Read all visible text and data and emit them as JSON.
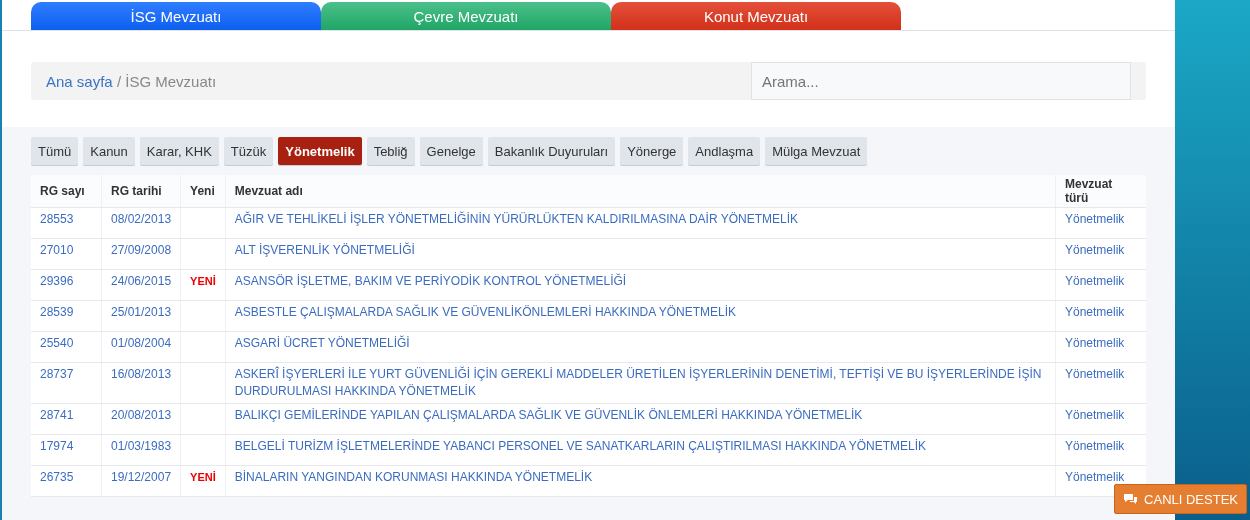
{
  "top_tabs": [
    {
      "label": "İSG Mevzuatı",
      "kind": "blue"
    },
    {
      "label": "Çevre Mevzuatı",
      "kind": "green"
    },
    {
      "label": "Konut Mevzuatı",
      "kind": "red"
    }
  ],
  "breadcrumb": {
    "home": "Ana sayfa",
    "separator": "/",
    "current": "İSG Mevzuatı"
  },
  "search": {
    "placeholder": "Arama..."
  },
  "filters": [
    {
      "label": "Tümü",
      "selected": false
    },
    {
      "label": "Kanun",
      "selected": false
    },
    {
      "label": "Karar, KHK",
      "selected": false
    },
    {
      "label": "Tüzük",
      "selected": false
    },
    {
      "label": "Yönetmelik",
      "selected": true
    },
    {
      "label": "Tebliğ",
      "selected": false
    },
    {
      "label": "Genelge",
      "selected": false
    },
    {
      "label": "Bakanlık Duyuruları",
      "selected": false
    },
    {
      "label": "Yönerge",
      "selected": false
    },
    {
      "label": "Andlaşma",
      "selected": false
    },
    {
      "label": "Mülga Mevzuat",
      "selected": false
    }
  ],
  "table": {
    "columns": [
      "RG sayı",
      "RG tarihi",
      "Yeni",
      "Mevzuat adı",
      "Mevzuat türü"
    ],
    "rows": [
      {
        "number": "28553",
        "date": "08/02/2013",
        "new": "",
        "title": "AĞIR VE TEHLİKELİ İŞLER YÖNETMELİĞİNİN YÜRÜRLÜKTEN KALDIRILMASINA DAİR YÖNETMELİK",
        "type": "Yönetmelik"
      },
      {
        "number": "27010",
        "date": "27/09/2008",
        "new": "",
        "title": "ALT İŞVERENLİK YÖNETMELİĞİ",
        "type": "Yönetmelik"
      },
      {
        "number": "29396",
        "date": "24/06/2015",
        "new": "YENİ",
        "title": "ASANSÖR İŞLETME, BAKIM VE PERİYODİK KONTROL YÖNETMELİĞİ",
        "type": "Yönetmelik"
      },
      {
        "number": "28539",
        "date": "25/01/2013",
        "new": "",
        "title": "ASBESTLE ÇALIŞMALARDA SAĞLIK VE GÜVENLİKÖNLEMLERİ HAKKINDA YÖNETMELİK",
        "type": "Yönetmelik"
      },
      {
        "number": "25540",
        "date": "01/08/2004",
        "new": "",
        "title": "ASGARİ ÜCRET YÖNETMELİĞİ",
        "type": "Yönetmelik"
      },
      {
        "number": "28737",
        "date": "16/08/2013",
        "new": "",
        "title": "ASKERÎ İŞYERLERİ İLE YURT GÜVENLİĞİ İÇİN GEREKLİ MADDELER ÜRETİLEN İŞYERLERİNİN DENETİMİ, TEFTİŞİ VE BU İŞYERLERİNDE İŞİN DURDURULMASI HAKKINDA YÖNETMELİK",
        "type": "Yönetmelik"
      },
      {
        "number": "28741",
        "date": "20/08/2013",
        "new": "",
        "title": "BALIKÇI GEMİLERİNDE YAPILAN ÇALIŞMALARDA SAĞLIK VE GÜVENLİK ÖNLEMLERİ HAKKINDA YÖNETMELİK",
        "type": "Yönetmelik"
      },
      {
        "number": "17974",
        "date": "01/03/1983",
        "new": "",
        "title": "BELGELİ TURİZM İŞLETMELERİNDE YABANCI PERSONEL VE SANATKARLARIN ÇALIŞTIRILMASI HAKKINDA YÖNETMELİK",
        "type": "Yönetmelik"
      },
      {
        "number": "26735",
        "date": "19/12/2007",
        "new": "YENİ",
        "title": "BİNALARIN YANGINDAN KORUNMASI HAKKINDA YÖNETMELİK",
        "type": "Yönetmelik"
      }
    ]
  },
  "support_button": {
    "label": "CANLI DESTEK"
  }
}
